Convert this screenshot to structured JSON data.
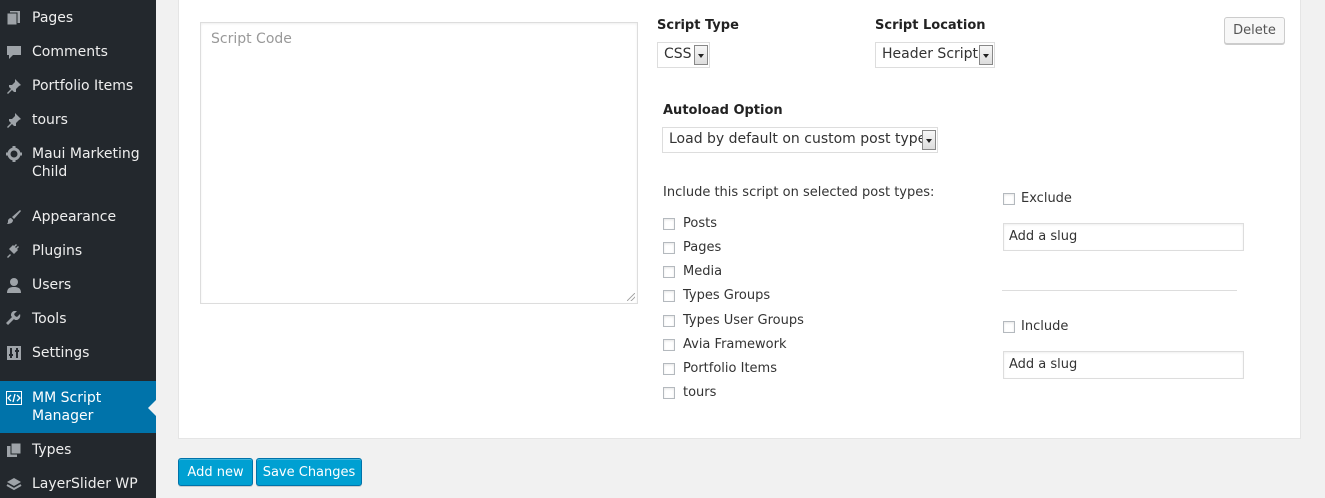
{
  "sidebar": {
    "items": [
      {
        "label": "Pages",
        "icon": "pages-icon"
      },
      {
        "label": "Comments",
        "icon": "comments-icon"
      },
      {
        "label": "Portfolio Items",
        "icon": "pin-icon"
      },
      {
        "label": "tours",
        "icon": "pin-icon"
      },
      {
        "label": "Maui Marketing Child",
        "icon": "gear-icon"
      },
      {
        "label": "Appearance",
        "icon": "brush-icon"
      },
      {
        "label": "Plugins",
        "icon": "plug-icon"
      },
      {
        "label": "Users",
        "icon": "user-icon"
      },
      {
        "label": "Tools",
        "icon": "wrench-icon"
      },
      {
        "label": "Settings",
        "icon": "sliders-icon"
      },
      {
        "label": "MM Script Manager",
        "icon": "code-icon",
        "active": true
      },
      {
        "label": "Types",
        "icon": "types-icon"
      },
      {
        "label": "LayerSlider WP",
        "icon": "layers-icon"
      }
    ],
    "active_color": "#0073aa",
    "bg_color": "#23282d"
  },
  "script": {
    "code_placeholder": "Script Code",
    "type_label": "Script Type",
    "type_value": "CSS",
    "location_label": "Script Location",
    "location_value": "Header Script",
    "delete_label": "Delete",
    "autoload_label": "Autoload Option",
    "autoload_value": "Load by default on custom post types",
    "include_heading": "Include this script on selected post types:",
    "post_types": [
      "Posts",
      "Pages",
      "Media",
      "Types Groups",
      "Types User Groups",
      "Avia Framework",
      "Portfolio Items",
      "tours"
    ],
    "exclude_label": "Exclude",
    "exclude_slug_value": "Add a slug",
    "include_label": "Include",
    "include_slug_value": "Add a slug"
  },
  "actions": {
    "add_new_label": "Add new",
    "save_label": "Save Changes"
  }
}
